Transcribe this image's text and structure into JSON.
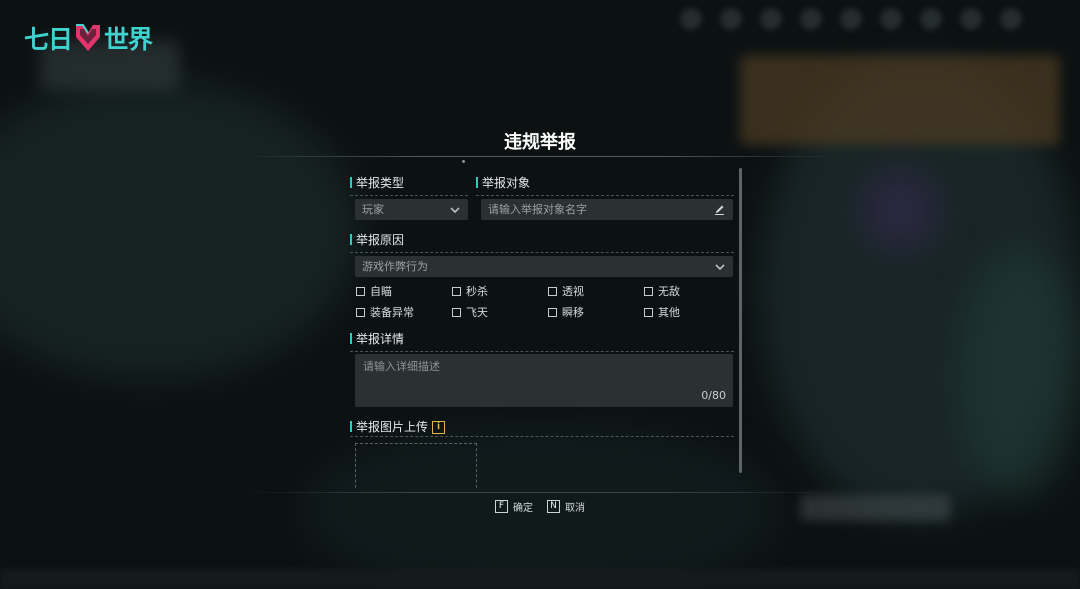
{
  "logo": {
    "left_text": "七日",
    "right_text": "世界"
  },
  "dialog": {
    "title": "违规举报",
    "sections": {
      "type": {
        "label": "举报类型",
        "value": "玩家"
      },
      "target": {
        "label": "举报对象",
        "placeholder": "请输入举报对象名字"
      },
      "reason": {
        "label": "举报原因",
        "value": "游戏作弊行为",
        "options": [
          "自瞄",
          "秒杀",
          "透视",
          "无敌",
          "装备异常",
          "飞天",
          "瞬移",
          "其他"
        ]
      },
      "details": {
        "label": "举报详情",
        "placeholder": "请输入详细描述",
        "counter": "0/80"
      },
      "upload": {
        "label": "举报图片上传",
        "info_icon": "i"
      }
    }
  },
  "footer": {
    "confirm": {
      "key": "F",
      "label": "确定"
    },
    "cancel": {
      "key": "N",
      "label": "取消"
    }
  },
  "colors": {
    "accent": "#35c9c1",
    "logo": "#3fd3cf",
    "logo_mark": "#e0356a",
    "info": "#e3b341"
  }
}
